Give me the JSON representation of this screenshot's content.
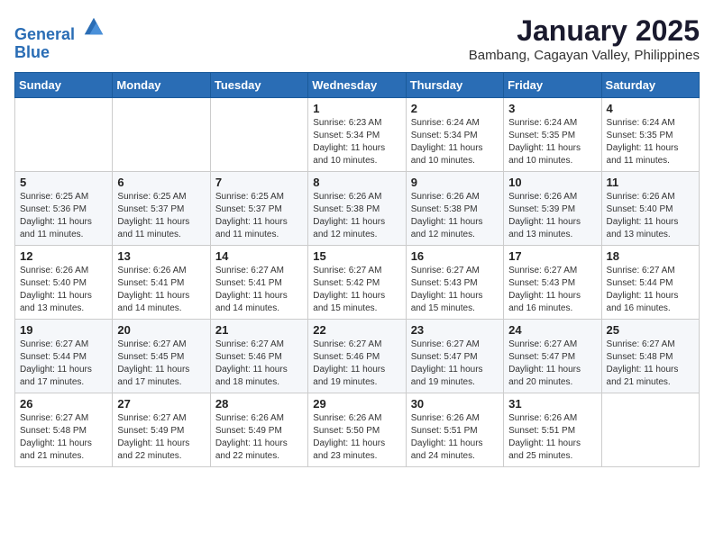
{
  "header": {
    "logo_line1": "General",
    "logo_line2": "Blue",
    "month_title": "January 2025",
    "subtitle": "Bambang, Cagayan Valley, Philippines"
  },
  "days_of_week": [
    "Sunday",
    "Monday",
    "Tuesday",
    "Wednesday",
    "Thursday",
    "Friday",
    "Saturday"
  ],
  "weeks": [
    [
      {
        "day": "",
        "info": ""
      },
      {
        "day": "",
        "info": ""
      },
      {
        "day": "",
        "info": ""
      },
      {
        "day": "1",
        "info": "Sunrise: 6:23 AM\nSunset: 5:34 PM\nDaylight: 11 hours and 10 minutes."
      },
      {
        "day": "2",
        "info": "Sunrise: 6:24 AM\nSunset: 5:34 PM\nDaylight: 11 hours and 10 minutes."
      },
      {
        "day": "3",
        "info": "Sunrise: 6:24 AM\nSunset: 5:35 PM\nDaylight: 11 hours and 10 minutes."
      },
      {
        "day": "4",
        "info": "Sunrise: 6:24 AM\nSunset: 5:35 PM\nDaylight: 11 hours and 11 minutes."
      }
    ],
    [
      {
        "day": "5",
        "info": "Sunrise: 6:25 AM\nSunset: 5:36 PM\nDaylight: 11 hours and 11 minutes."
      },
      {
        "day": "6",
        "info": "Sunrise: 6:25 AM\nSunset: 5:37 PM\nDaylight: 11 hours and 11 minutes."
      },
      {
        "day": "7",
        "info": "Sunrise: 6:25 AM\nSunset: 5:37 PM\nDaylight: 11 hours and 11 minutes."
      },
      {
        "day": "8",
        "info": "Sunrise: 6:26 AM\nSunset: 5:38 PM\nDaylight: 11 hours and 12 minutes."
      },
      {
        "day": "9",
        "info": "Sunrise: 6:26 AM\nSunset: 5:38 PM\nDaylight: 11 hours and 12 minutes."
      },
      {
        "day": "10",
        "info": "Sunrise: 6:26 AM\nSunset: 5:39 PM\nDaylight: 11 hours and 13 minutes."
      },
      {
        "day": "11",
        "info": "Sunrise: 6:26 AM\nSunset: 5:40 PM\nDaylight: 11 hours and 13 minutes."
      }
    ],
    [
      {
        "day": "12",
        "info": "Sunrise: 6:26 AM\nSunset: 5:40 PM\nDaylight: 11 hours and 13 minutes."
      },
      {
        "day": "13",
        "info": "Sunrise: 6:26 AM\nSunset: 5:41 PM\nDaylight: 11 hours and 14 minutes."
      },
      {
        "day": "14",
        "info": "Sunrise: 6:27 AM\nSunset: 5:41 PM\nDaylight: 11 hours and 14 minutes."
      },
      {
        "day": "15",
        "info": "Sunrise: 6:27 AM\nSunset: 5:42 PM\nDaylight: 11 hours and 15 minutes."
      },
      {
        "day": "16",
        "info": "Sunrise: 6:27 AM\nSunset: 5:43 PM\nDaylight: 11 hours and 15 minutes."
      },
      {
        "day": "17",
        "info": "Sunrise: 6:27 AM\nSunset: 5:43 PM\nDaylight: 11 hours and 16 minutes."
      },
      {
        "day": "18",
        "info": "Sunrise: 6:27 AM\nSunset: 5:44 PM\nDaylight: 11 hours and 16 minutes."
      }
    ],
    [
      {
        "day": "19",
        "info": "Sunrise: 6:27 AM\nSunset: 5:44 PM\nDaylight: 11 hours and 17 minutes."
      },
      {
        "day": "20",
        "info": "Sunrise: 6:27 AM\nSunset: 5:45 PM\nDaylight: 11 hours and 17 minutes."
      },
      {
        "day": "21",
        "info": "Sunrise: 6:27 AM\nSunset: 5:46 PM\nDaylight: 11 hours and 18 minutes."
      },
      {
        "day": "22",
        "info": "Sunrise: 6:27 AM\nSunset: 5:46 PM\nDaylight: 11 hours and 19 minutes."
      },
      {
        "day": "23",
        "info": "Sunrise: 6:27 AM\nSunset: 5:47 PM\nDaylight: 11 hours and 19 minutes."
      },
      {
        "day": "24",
        "info": "Sunrise: 6:27 AM\nSunset: 5:47 PM\nDaylight: 11 hours and 20 minutes."
      },
      {
        "day": "25",
        "info": "Sunrise: 6:27 AM\nSunset: 5:48 PM\nDaylight: 11 hours and 21 minutes."
      }
    ],
    [
      {
        "day": "26",
        "info": "Sunrise: 6:27 AM\nSunset: 5:48 PM\nDaylight: 11 hours and 21 minutes."
      },
      {
        "day": "27",
        "info": "Sunrise: 6:27 AM\nSunset: 5:49 PM\nDaylight: 11 hours and 22 minutes."
      },
      {
        "day": "28",
        "info": "Sunrise: 6:26 AM\nSunset: 5:49 PM\nDaylight: 11 hours and 22 minutes."
      },
      {
        "day": "29",
        "info": "Sunrise: 6:26 AM\nSunset: 5:50 PM\nDaylight: 11 hours and 23 minutes."
      },
      {
        "day": "30",
        "info": "Sunrise: 6:26 AM\nSunset: 5:51 PM\nDaylight: 11 hours and 24 minutes."
      },
      {
        "day": "31",
        "info": "Sunrise: 6:26 AM\nSunset: 5:51 PM\nDaylight: 11 hours and 25 minutes."
      },
      {
        "day": "",
        "info": ""
      }
    ]
  ]
}
